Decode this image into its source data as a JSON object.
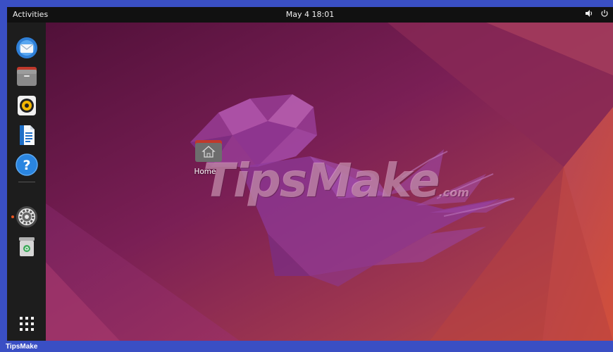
{
  "topbar": {
    "activities_label": "Activities",
    "clock": "May 4  18:01"
  },
  "tray": {
    "volume_icon": "volume-icon",
    "power_icon": "power-icon"
  },
  "dock": {
    "items": [
      {
        "name": "thunderbird",
        "icon": "thunderbird-mail-icon"
      },
      {
        "name": "files",
        "icon": "files-folder-icon"
      },
      {
        "name": "rhythmbox",
        "icon": "rhythmbox-speaker-icon"
      },
      {
        "name": "libreoffice-writer",
        "icon": "writer-document-icon"
      },
      {
        "name": "help",
        "icon": "help-question-icon"
      },
      {
        "name": "settings",
        "icon": "settings-gear-icon",
        "running": true
      },
      {
        "name": "trash",
        "icon": "trash-recycle-icon"
      }
    ],
    "show_apps_icon": "app-grid-icon"
  },
  "desktop": {
    "home_label": "Home"
  },
  "watermark": {
    "main": "TipsMake",
    "suffix": ".com"
  },
  "caption": "TipsMake",
  "colors": {
    "frame_border": "#3a4fc4",
    "topbar": "#111111",
    "dock": "#1d1d1d",
    "accent": "#e95420"
  }
}
